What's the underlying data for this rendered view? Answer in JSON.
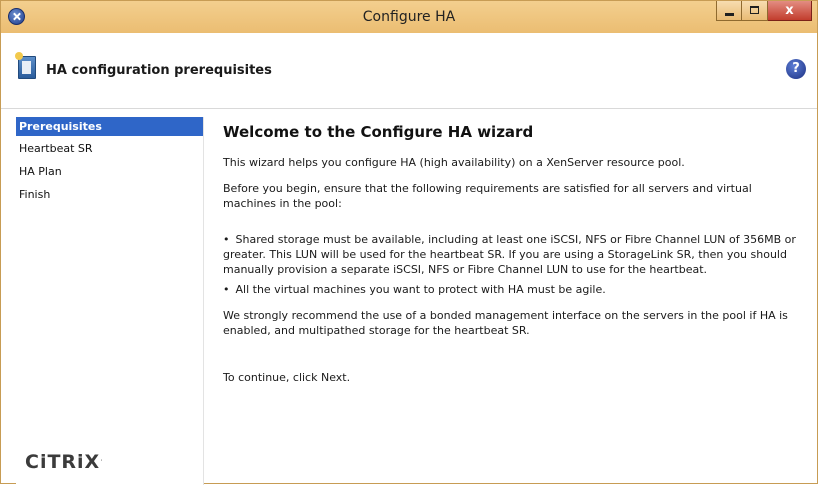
{
  "window": {
    "title": "Configure HA",
    "minimize_label": "",
    "maximize_label": "",
    "close_label": "x"
  },
  "header": {
    "title": "HA configuration prerequisites",
    "help_label": "?"
  },
  "sidebar": {
    "steps": [
      {
        "label": "Prerequisites",
        "active": true
      },
      {
        "label": "Heartbeat SR",
        "active": false
      },
      {
        "label": "HA Plan",
        "active": false
      },
      {
        "label": "Finish",
        "active": false
      }
    ],
    "logo_text": "CiTRiX",
    "logo_mark": "."
  },
  "main": {
    "heading": "Welcome to the Configure HA wizard",
    "intro": "This wizard helps you configure HA (high availability) on a XenServer resource pool.",
    "before_begin": "Before you begin, ensure that the following requirements are satisfied for all servers and virtual machines in the pool:",
    "bullet_char": "•",
    "requirement_1": "Shared storage must be available, including at least one iSCSI, NFS or Fibre Channel LUN of 356MB or greater. This LUN will be used for the heartbeat SR. If you are using a StorageLink SR, then you should manually provision a separate iSCSI, NFS or Fibre Channel LUN to use for the heartbeat.",
    "requirement_2": "All the virtual machines you want to protect with HA must be agile.",
    "recommendation": "We strongly recommend the use of a bonded management interface on the servers in the pool if HA is enabled, and multipathed storage for the heartbeat SR.",
    "continue_text": "To continue, click Next."
  },
  "colors": {
    "titlebar": "#ebbd72",
    "active_step": "#2f66c8",
    "close_button": "#c23d2d"
  }
}
